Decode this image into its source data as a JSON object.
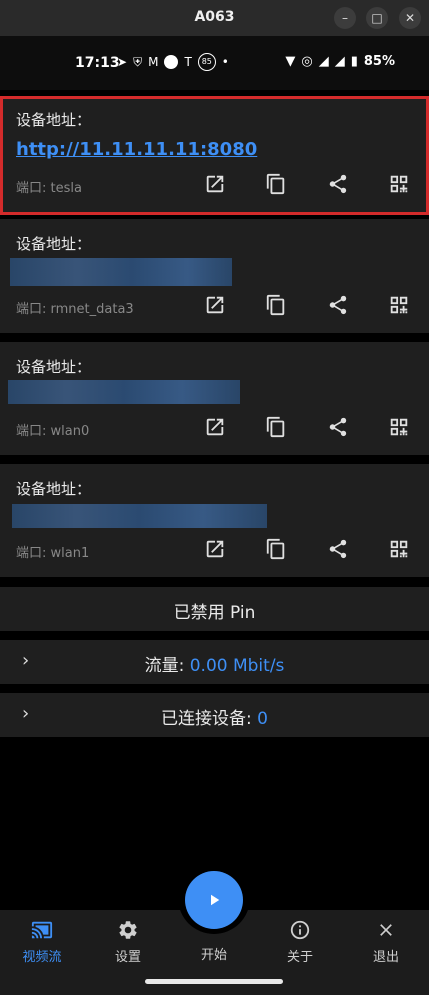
{
  "window": {
    "title": "A063"
  },
  "statusbar": {
    "time": "17:13",
    "battery": "85%",
    "badge": "85"
  },
  "cards": [
    {
      "label": "设备地址：",
      "address": "http://11.11.11.11:8080",
      "port": "端口: tesla"
    },
    {
      "label": "设备地址：",
      "address": "",
      "port": "端口: rmnet_data3"
    },
    {
      "label": "设备地址：",
      "address": "",
      "port": "端口: wlan0"
    },
    {
      "label": "设备地址：",
      "address": "",
      "port": "端口: wlan1"
    }
  ],
  "pin": {
    "label": "已禁用 Pin"
  },
  "traffic": {
    "label": "流量: ",
    "value": "0.00 Mbit/s"
  },
  "connected": {
    "label": "已连接设备: ",
    "value": "0"
  },
  "nav": {
    "stream": "视频流",
    "settings": "设置",
    "start": "开始",
    "about": "关于",
    "exit": "退出"
  },
  "colors": {
    "accent": "#3e8ff5",
    "highlight": "#d32b2b",
    "card": "#1f1f1f"
  }
}
